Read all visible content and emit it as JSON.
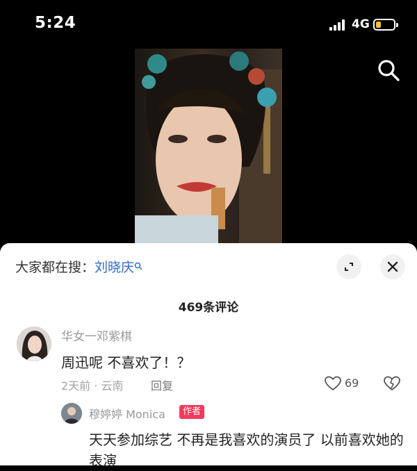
{
  "status_bar": {
    "time": "5:24",
    "network": "4G"
  },
  "search": {
    "hint": "大家都在搜：",
    "keyword": "刘晓庆"
  },
  "comments": {
    "count_label": "469条评论",
    "items": [
      {
        "username": "华女一邓紫棋",
        "text": "周迅呢 不喜欢了！？",
        "meta": "2天前 · 云南",
        "reply_label": "回复",
        "likes": "69",
        "replies": [
          {
            "username": "穆婷婷 Monica",
            "badge": "作者",
            "text": "天天参加综艺 不再是我喜欢的演员了 以前喜欢她的表演"
          }
        ]
      }
    ]
  },
  "colors": {
    "keyword": "#2f6cc8",
    "author_badge": "#f3395c",
    "battery": "#f2c12e"
  }
}
